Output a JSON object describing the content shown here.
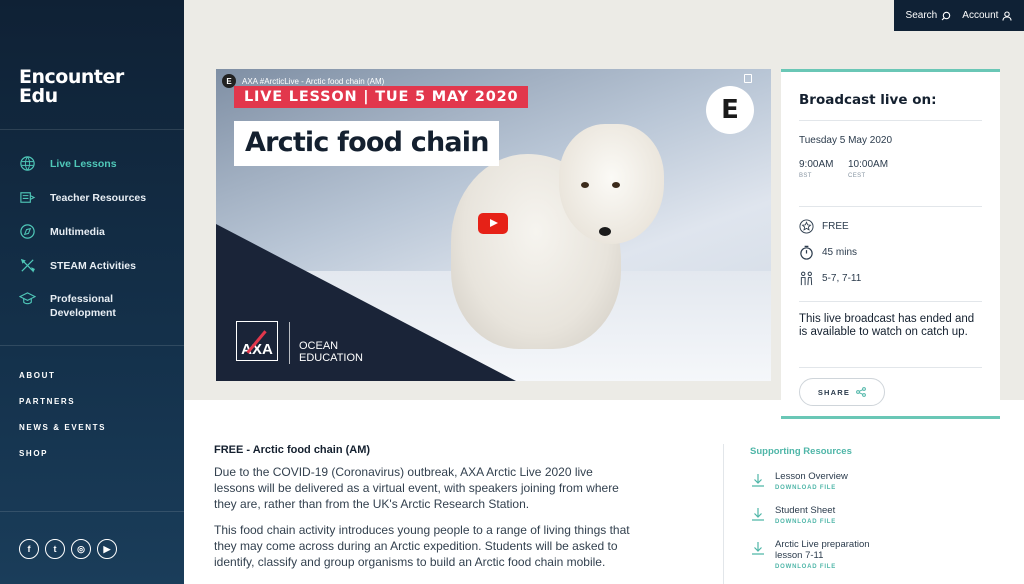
{
  "brand": {
    "line1": "Encounter",
    "line2": "Edu"
  },
  "topbar": {
    "search": "Search",
    "account": "Account"
  },
  "sidebar": {
    "items": [
      {
        "label": "Live Lessons",
        "icon": "globe-icon"
      },
      {
        "label": "Teacher Resources",
        "icon": "resources-icon"
      },
      {
        "label": "Multimedia",
        "icon": "compass-icon"
      },
      {
        "label": "STEAM Activities",
        "icon": "tools-icon"
      },
      {
        "label": "Professional Development",
        "label1": "Professional",
        "label2": "Development",
        "icon": "graduation-cap-icon"
      }
    ],
    "secondary": [
      "ABOUT",
      "PARTNERS",
      "NEWS & EVENTS",
      "SHOP"
    ],
    "social": {
      "facebook": "f",
      "twitter": "t",
      "instagram": "◎",
      "youtube": "▶"
    }
  },
  "video": {
    "channel_title": "AXA #ArcticLive - Arctic food chain (AM)",
    "banner": "LIVE LESSON | TUE 5 MAY 2020",
    "lesson_title": "Arctic food chain",
    "badge": "E",
    "small_badge": "E",
    "partner_logo": "AXA",
    "ocean_line1": "OCEAN",
    "ocean_line2": "EDUCATION"
  },
  "broadcast": {
    "title": "Broadcast live on:",
    "date": "Tuesday 5 May 2020",
    "times": [
      {
        "time": "9:00AM",
        "zone": "BST"
      },
      {
        "time": "10:00AM",
        "zone": "CEST"
      }
    ],
    "price": "FREE",
    "duration": "45 mins",
    "ages": "5-7, 7-11",
    "status": "This live broadcast has ended and is available to watch on catch up.",
    "share": "SHARE"
  },
  "content": {
    "heading": "FREE - Arctic food chain (AM)",
    "para1": "Due to the COVID-19 (Coronavirus) outbreak, AXA Arctic Live 2020 live lessons will be delivered as a virtual event, with speakers joining from where they are, rather than from the UK's Arctic Research Station.",
    "para2": "This food chain activity introduces young people to a range of living things that they may come across during an Arctic expedition. Students will be asked to identify, classify and group organisms to build an Arctic food chain mobile."
  },
  "resources": {
    "title": "Supporting Resources",
    "download_label": "DOWNLOAD FILE",
    "items": [
      {
        "name": "Lesson Overview"
      },
      {
        "name": "Student Sheet"
      },
      {
        "name": "Arctic Live preparation lesson 7-11"
      }
    ]
  },
  "colors": {
    "accent": "#4fc7b8",
    "sidebar": "#0f2135",
    "banner_red": "#e2374c"
  }
}
